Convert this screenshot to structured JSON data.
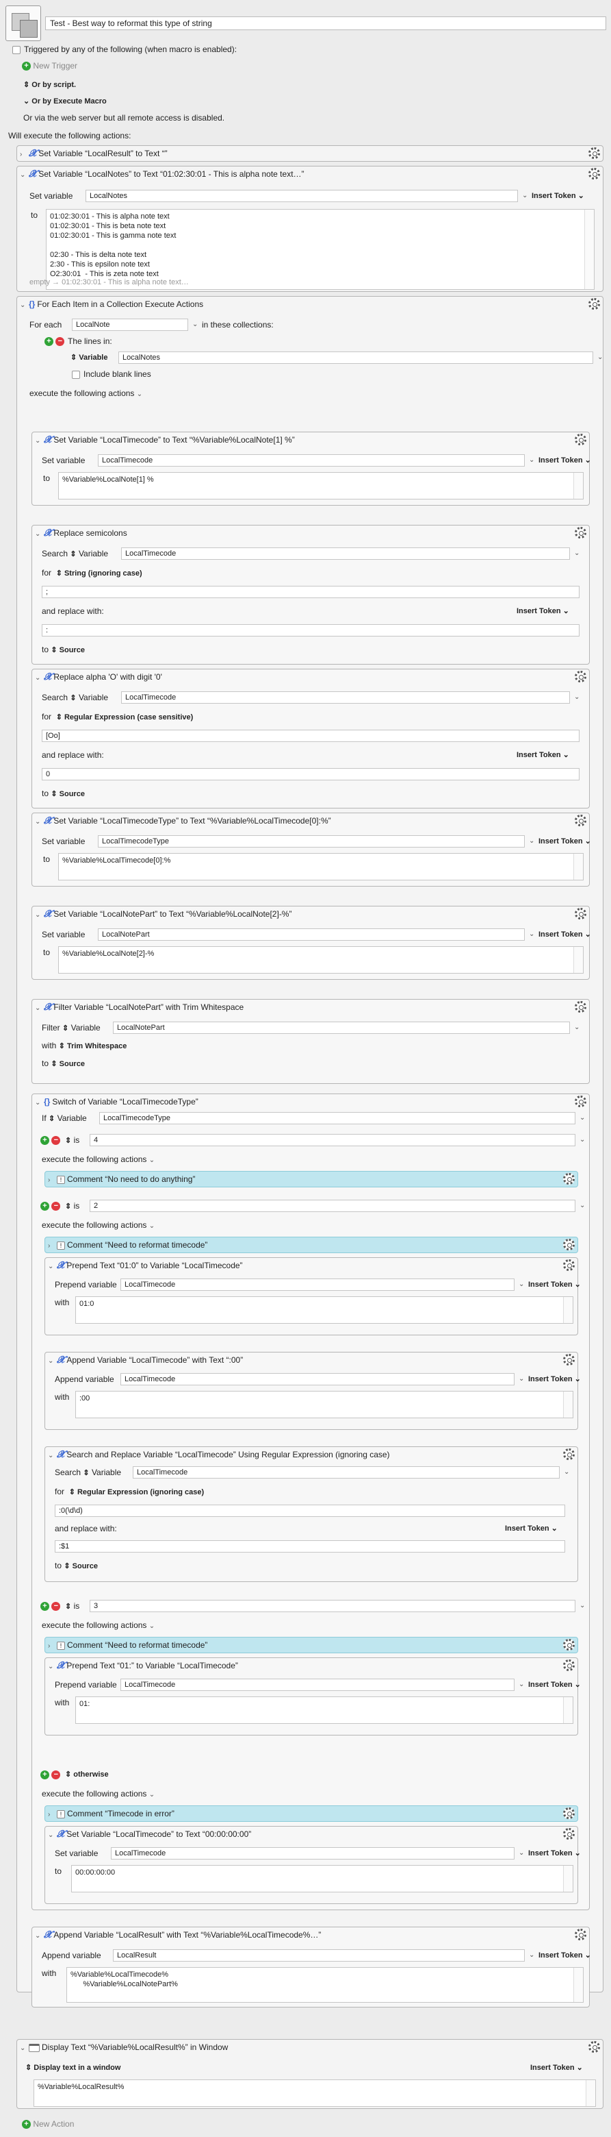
{
  "macro": {
    "title": "Test - Best way to reformat this type of string",
    "trigger_text": "Triggered by any of the following (when macro is enabled):",
    "new_trigger": "New Trigger",
    "or_script": "Or by script.",
    "or_execute": "Or by Execute Macro",
    "web_server": "Or via the web server but all remote access is disabled.",
    "will_execute": "Will execute the following actions:"
  },
  "common": {
    "insert_token": "Insert Token",
    "set_variable": "Set variable",
    "append_variable": "Append variable",
    "prepend_variable": "Prepend variable",
    "to": "to",
    "with": "with",
    "for": "for",
    "search": "Search",
    "variable": "Variable",
    "and_replace": "and replace with:",
    "to_source": "to",
    "source": "Source",
    "execute": "execute the following actions",
    "is": "is",
    "if": "If"
  },
  "a1": {
    "title": "Set Variable “LocalResult” to Text “”"
  },
  "a2": {
    "title": "Set Variable “LocalNotes” to Text “01:02:30:01 - This is alpha note text…”",
    "var": "LocalNotes",
    "text": "01:02:30:01 - This is alpha note text\n01:02:30:01 - This is beta note text\n01:02:30:01 - This is gamma note text\n\n02:30 - This is delta note text\n2:30 - This is epsilon note text\nO2:30:01  - This is zeta note text",
    "preview": "empty → 01:02:30:01 - This is alpha note text…"
  },
  "a3": {
    "title": "For Each Item in a Collection Execute Actions",
    "for_each": "For each",
    "var": "LocalNote",
    "in_these": "in these collections:",
    "lines_in": "The lines in:",
    "lines_var": "LocalNotes",
    "include_blank": "Include blank lines"
  },
  "b1": {
    "title": "Set Variable “LocalTimecode” to Text “%Variable%LocalNote[1] %”",
    "var": "LocalTimecode",
    "text": "%Variable%LocalNote[1] %"
  },
  "b2": {
    "title": "Replace semicolons",
    "var": "LocalTimecode",
    "mode": "String (ignoring case)",
    "search": ";",
    "replace": ":"
  },
  "b3": {
    "title": "Replace alpha 'O' with digit '0'",
    "var": "LocalTimecode",
    "mode": "Regular Expression (case sensitive)",
    "search": "[Oo]",
    "replace": "0"
  },
  "b4": {
    "title": "Set Variable “LocalTimecodeType” to Text “%Variable%LocalTimecode[0]:%”",
    "var": "LocalTimecodeType",
    "text": "%Variable%LocalTimecode[0]:%"
  },
  "b5": {
    "title": "Set Variable “LocalNotePart” to Text “%Variable%LocalNote[2]-%”",
    "var": "LocalNotePart",
    "text": "%Variable%LocalNote[2]-%"
  },
  "b6": {
    "title": "Filter Variable “LocalNotePart” with Trim Whitespace",
    "filter": "Filter",
    "var": "LocalNotePart",
    "op": "Trim Whitespace"
  },
  "b7": {
    "title": "Switch of Variable “LocalTimecodeType”",
    "var": "LocalTimecodeType",
    "case1": "4",
    "comment1": "Comment “No need to do anything”",
    "case2": "2",
    "comment2": "Comment “Need to reformat timecode”",
    "c2a": {
      "title": "Prepend Text “01:0” to Variable “LocalTimecode”",
      "var": "LocalTimecode",
      "text": "01:0"
    },
    "c2b": {
      "title": "Append Variable “LocalTimecode” with Text “:00”",
      "var": "LocalTimecode",
      "text": ":00"
    },
    "c2c": {
      "title": "Search and Replace Variable “LocalTimecode” Using Regular Expression (ignoring case)",
      "var": "LocalTimecode",
      "mode": "Regular Expression (ignoring case)",
      "search": ":0(\\d\\d)",
      "replace": ":$1"
    },
    "case3": "3",
    "comment3": "Comment “Need to reformat timecode”",
    "c3a": {
      "title": "Prepend Text “01:” to Variable “LocalTimecode”",
      "var": "LocalTimecode",
      "text": "01:"
    },
    "otherwise": "otherwise",
    "comment4": "Comment “Timecode in error”",
    "c4a": {
      "title": "Set Variable “LocalTimecode” to Text “00:00:00:00”",
      "var": "LocalTimecode",
      "text": "00:00:00:00"
    }
  },
  "b8": {
    "title": "Append Variable “LocalResult” with Text “%Variable%LocalTimecode%…”",
    "var": "LocalResult",
    "text": "%Variable%LocalTimecode%\n      %Variable%LocalNotePart%"
  },
  "a4": {
    "title": "Display Text “%Variable%LocalResult%” in Window",
    "mode": "Display text in a window",
    "text": "%Variable%LocalResult%"
  },
  "new_action": "New Action"
}
